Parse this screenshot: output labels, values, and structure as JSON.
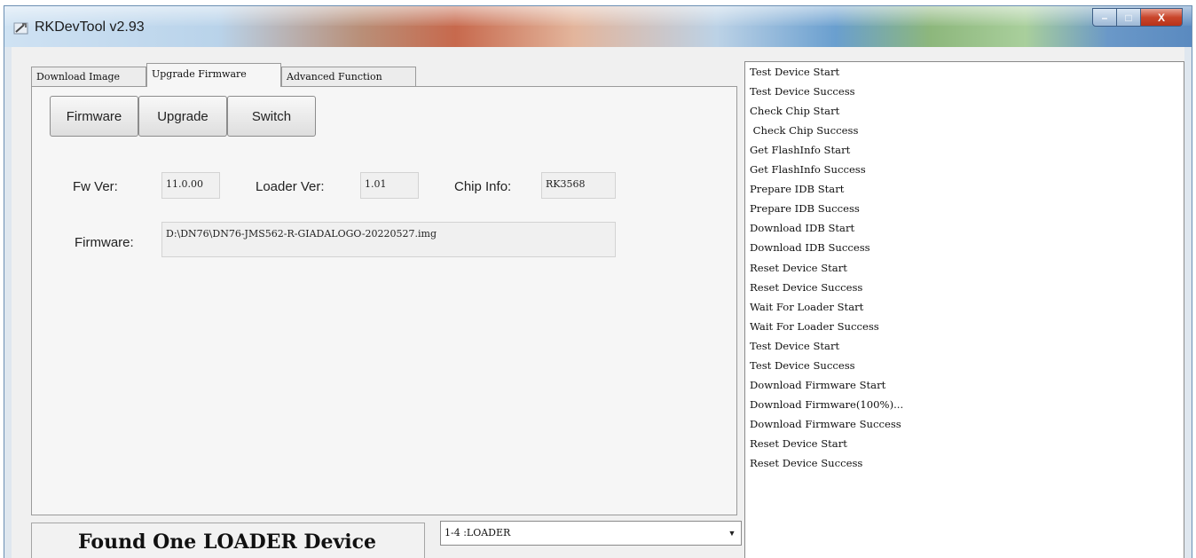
{
  "window": {
    "title": "RKDevTool v2.93",
    "controls": {
      "minimize": "–",
      "maximize": "□",
      "close": "X"
    }
  },
  "tabs": [
    {
      "label": "Download Image",
      "active": false
    },
    {
      "label": "Upgrade Firmware",
      "active": true
    },
    {
      "label": "Advanced Function",
      "active": false
    }
  ],
  "toolbar": {
    "firmware_label": "Firmware",
    "upgrade_label": "Upgrade",
    "switch_label": "Switch"
  },
  "info": {
    "fw_ver_label": "Fw Ver:",
    "fw_ver_value": "11.0.00",
    "loader_ver_label": "Loader Ver:",
    "loader_ver_value": "1.01",
    "chip_info_label": "Chip Info:",
    "chip_info_value": "RK3568",
    "firmware_label": "Firmware:",
    "firmware_path": "D:\\DN76\\DN76-JMS562-R-GIADALOGO-20220527.img"
  },
  "status": {
    "text": "Found One LOADER Device",
    "device_select": "1-4 :LOADER"
  },
  "log": [
    "Test Device Start",
    "Test Device Success",
    "Check Chip Start",
    " Check Chip Success",
    "Get FlashInfo Start",
    "Get FlashInfo Success",
    "Prepare IDB Start",
    "Prepare IDB Success",
    "Download IDB Start",
    "Download IDB Success",
    "Reset Device Start",
    "Reset Device Success",
    "Wait For Loader Start",
    "Wait For Loader Success",
    "Test Device Start",
    "Test Device Success",
    "Download Firmware Start",
    "Download Firmware(100%)...",
    "Download Firmware Success",
    "Reset Device Start",
    "Reset Device Success"
  ]
}
